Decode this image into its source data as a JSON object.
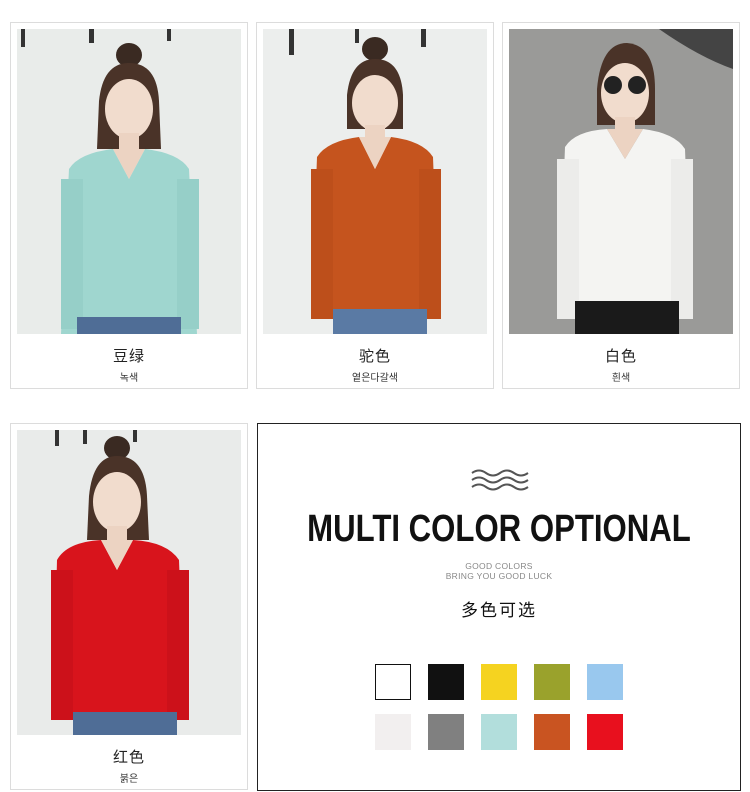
{
  "products": [
    {
      "name_cn": "豆绿",
      "name_kr": "녹색",
      "color": "#9fd6cf",
      "bg": "#e9ecea"
    },
    {
      "name_cn": "驼色",
      "name_kr": "옅은다갈색",
      "color": "#c5541e",
      "bg": "#eceeed"
    },
    {
      "name_cn": "白色",
      "name_kr": "흰색",
      "color": "#f4f4f2",
      "bg": "#9a9a98"
    },
    {
      "name_cn": "红色",
      "name_kr": "붉은",
      "color": "#d8141c",
      "bg": "#e9ebea"
    }
  ],
  "promo": {
    "headline": "MULTI COLOR OPTIONAL",
    "sub1": "GOOD COLORS",
    "sub2": "BRING YOU GOOD LUCK",
    "title_cn": "多色可选",
    "swatches": [
      "#ffffff",
      "#111111",
      "#f5d320",
      "#9aa22c",
      "#99c8ee",
      "#f2efef",
      "#808080",
      "#b2dedc",
      "#c95421",
      "#e8101e"
    ]
  }
}
